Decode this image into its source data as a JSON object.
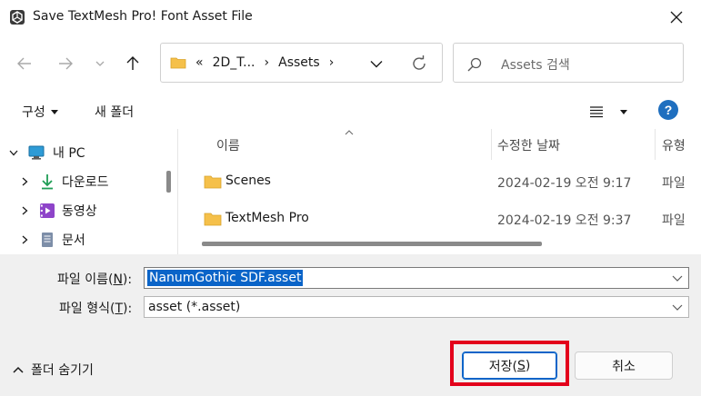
{
  "window": {
    "title": "Save TextMesh Pro! Font Asset File"
  },
  "nav": {
    "breadcrumb_overflow": "«",
    "breadcrumbs": [
      "2D_T...",
      "Assets"
    ],
    "separator": "›",
    "search_placeholder": "Assets 검색"
  },
  "toolbar": {
    "organize_label": "구성",
    "new_folder_label": "새 폴더",
    "help_label": "?"
  },
  "sidebar": {
    "items": [
      {
        "label": "내 PC",
        "icon": "pc-icon"
      },
      {
        "label": "다운로드",
        "icon": "download-icon"
      },
      {
        "label": "동영상",
        "icon": "video-icon"
      },
      {
        "label": "문서",
        "icon": "document-icon"
      }
    ]
  },
  "filelist": {
    "columns": {
      "name": "이름",
      "modified": "수정한 날짜",
      "type": "유형"
    },
    "rows": [
      {
        "name": "Scenes",
        "modified": "2024-02-19 오전 9:17",
        "type": "파일"
      },
      {
        "name": "TextMesh Pro",
        "modified": "2024-02-19 오전 9:37",
        "type": "파일"
      }
    ]
  },
  "form": {
    "filename_label_pre": "파일 이름(",
    "filename_label_key": "N",
    "filename_label_post": "):",
    "filename_value": "NanumGothic SDF.asset",
    "filetype_label_pre": "파일 형식(",
    "filetype_label_key": "T",
    "filetype_label_post": "):",
    "filetype_value": "asset (*.asset)"
  },
  "footer": {
    "hide_folders_label": "폴더 숨기기",
    "save_label_pre": "저장(",
    "save_label_key": "S",
    "save_label_post": ")",
    "cancel_label": "취소"
  },
  "colors": {
    "accent": "#0a64c8",
    "highlight": "#e3001b",
    "folder": "#f5c04a"
  }
}
